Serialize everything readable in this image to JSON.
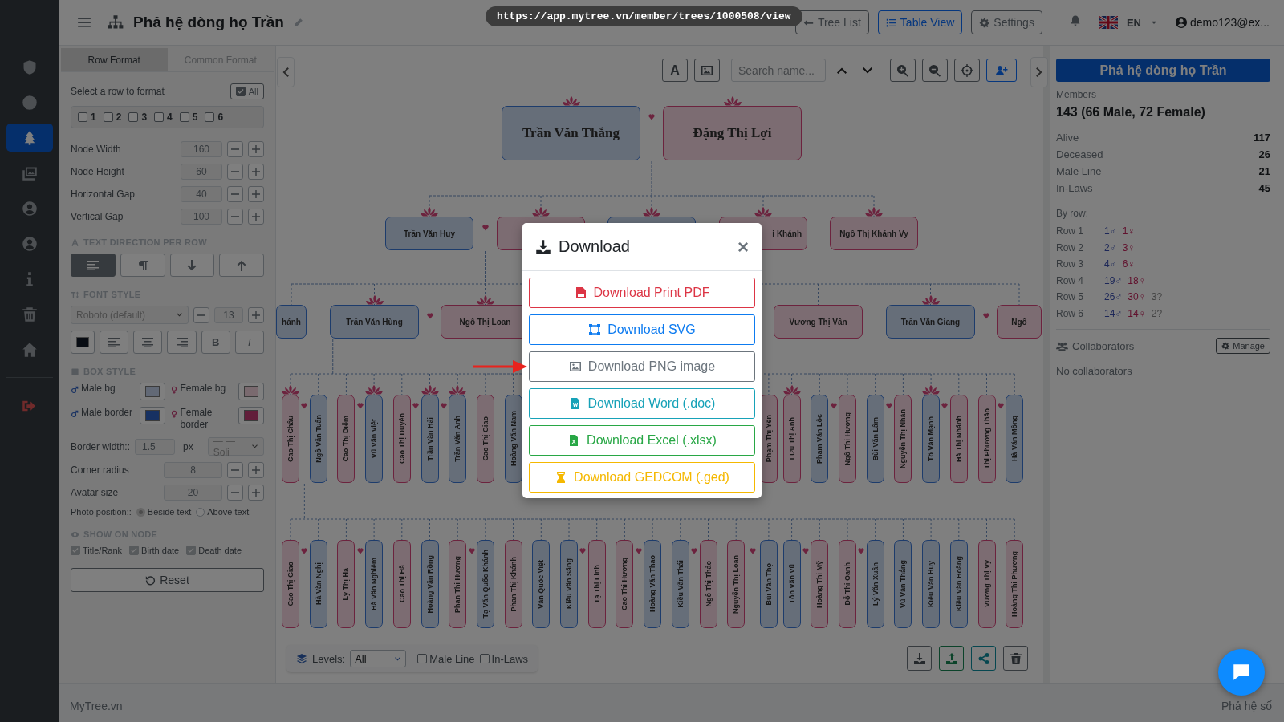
{
  "sidebar": {
    "items": [
      {
        "kind": "shield",
        "selected": false
      },
      {
        "kind": "circle",
        "selected": false
      },
      {
        "kind": "tree",
        "selected": true
      },
      {
        "kind": "images",
        "selected": false
      },
      {
        "kind": "user-circle",
        "selected": false
      },
      {
        "kind": "user-circle",
        "selected": false
      },
      {
        "kind": "info",
        "selected": false
      },
      {
        "kind": "trash",
        "selected": false
      },
      {
        "kind": "home",
        "selected": false
      },
      {
        "kind": "sign-out",
        "selected": false
      }
    ]
  },
  "header": {
    "title": "Phả hệ dòng họ Trần",
    "url": "https://app.mytree.vn/member/trees/1000508/view",
    "buttons": [
      {
        "label": "Tree List",
        "kind": "back",
        "selected": false
      },
      {
        "label": "Table View",
        "kind": "list",
        "selected": true
      },
      {
        "label": "Settings",
        "kind": "gear",
        "selected": false
      }
    ],
    "language": "EN",
    "user": "demo123@ex..."
  },
  "format_panel": {
    "tabs": [
      {
        "label": "Row Format",
        "selected": true
      },
      {
        "label": "Common Format",
        "selected": false
      }
    ],
    "row_select": {
      "label": "Select a row to format",
      "all": {
        "label": "All",
        "checked": true
      },
      "rows": [
        {
          "label": "1",
          "checked": false
        },
        {
          "label": "2",
          "checked": false
        },
        {
          "label": "3",
          "checked": false
        },
        {
          "label": "4",
          "checked": false
        },
        {
          "label": "5",
          "checked": false
        },
        {
          "label": "6",
          "checked": false
        }
      ]
    },
    "size_fields": [
      {
        "label": "Node Width",
        "value": "160"
      },
      {
        "label": "Node Height",
        "value": "60"
      },
      {
        "label": "Horizontal Gap",
        "value": "40"
      },
      {
        "label": "Vertical Gap",
        "value": "100"
      }
    ],
    "text_direction": {
      "title": "TEXT DIRECTION PER ROW",
      "options": [
        {
          "kind": "align-left",
          "selected": true
        },
        {
          "kind": "pilcrow",
          "selected": false
        },
        {
          "kind": "arrow-down",
          "selected": false
        },
        {
          "kind": "arrow-up",
          "selected": false
        }
      ]
    },
    "font_style": {
      "title": "FONT STYLE",
      "font": "Roboto (default)",
      "size": "13",
      "buttons": [
        {
          "kind": "align-left"
        },
        {
          "kind": "align-center"
        },
        {
          "kind": "align-right"
        },
        {
          "kind": "bold",
          "label": "B"
        },
        {
          "kind": "italic",
          "label": "I"
        }
      ]
    },
    "box_style": {
      "title": "BOX STYLE",
      "swatches": [
        {
          "label": "Male bg",
          "kind": "male-bg"
        },
        {
          "label": "Female bg",
          "kind": "female-bg"
        },
        {
          "label": "Male border",
          "kind": "male-border"
        },
        {
          "label": "Female border",
          "kind": "female-border"
        }
      ],
      "border_width": {
        "label": "Border width::",
        "value": "1.5",
        "unit": "px",
        "style": "— — Soli"
      },
      "steppers": [
        {
          "label": "Corner radius",
          "value": "8"
        },
        {
          "label": "Avatar size",
          "value": "20"
        }
      ],
      "photo_position": {
        "label": "Photo position::",
        "options": [
          {
            "label": "Beside text",
            "selected": true
          },
          {
            "label": "Above text",
            "selected": false
          }
        ]
      }
    },
    "show_on_node": {
      "title": "SHOW ON NODE",
      "options": [
        {
          "label": "Title/Rank",
          "checked": true
        },
        {
          "label": "Birth date",
          "checked": true
        },
        {
          "label": "Death date",
          "checked": true
        }
      ]
    },
    "reset": "Reset"
  },
  "canvas": {
    "toolbar": {
      "font_button": "A",
      "search_placeholder": "Search name..."
    },
    "tree": [
      {
        "nodes": [
          {
            "name": "Trần Văn Thắng",
            "kind": "male",
            "lotus": true,
            "married": true
          },
          {
            "name": "Đặng Thị Lợi",
            "kind": "female",
            "lotus": true,
            "married": false
          }
        ]
      },
      {
        "nodes": [
          {
            "name": "Trần Văn Huy",
            "kind": "male",
            "lotus": true,
            "married": true
          },
          {
            "kind": "female",
            "lotus": true
          },
          {
            "kind": "male",
            "lotus": true
          },
          {
            "name": "i Khánh",
            "kind": "female",
            "lotus": true,
            "married": false
          },
          {
            "name": "Ngô Thị Khánh Vy",
            "kind": "female",
            "lotus": true,
            "married": false
          }
        ]
      },
      {
        "nodes": [
          {
            "name": "hánh",
            "kind": "male",
            "lotus": false,
            "married": false
          },
          {
            "name": "Trần Văn Hùng",
            "kind": "male",
            "lotus": true,
            "married": true
          },
          {
            "name": "Ngô Thị Loan",
            "kind": "female",
            "lotus": true,
            "married": false
          },
          {
            "name": "Vương Thị Vân",
            "kind": "female",
            "lotus": false,
            "married": false
          },
          {
            "name": "Trần Văn Giang",
            "kind": "male",
            "lotus": true,
            "married": true
          },
          {
            "name": "Ngô",
            "kind": "female",
            "lotus": false,
            "married": false
          }
        ]
      },
      {
        "nodes": [
          {
            "name": "Cao Thị Châu",
            "kind": "female",
            "lotus": true,
            "married": true
          },
          {
            "name": "Ngô Văn Tuấn",
            "kind": "male",
            "lotus": false,
            "married": false
          },
          {
            "name": "Cao Thị Diễm",
            "kind": "female",
            "lotus": false,
            "married": true
          },
          {
            "name": "Vũ Văn Việt",
            "kind": "male",
            "lotus": true,
            "married": false
          },
          {
            "name": "Cao Thị Duyên",
            "kind": "female",
            "lotus": false,
            "married": true
          },
          {
            "name": "Trần Văn Hải",
            "kind": "male",
            "lotus": true,
            "married": true
          },
          {
            "name": "Trần Văn Anh",
            "kind": "male",
            "lotus": true,
            "married": false
          },
          {
            "name": "Cao Thị Giao",
            "kind": "female",
            "lotus": false,
            "married": false
          },
          {
            "name": "Hoàng Văn Nam",
            "kind": "male",
            "lotus": false,
            "married": false
          },
          {
            "name": "Phạm Thị Yến",
            "kind": "female",
            "lotus": false,
            "married": false
          },
          {
            "name": "Lưu Thị Anh",
            "kind": "female",
            "lotus": true,
            "married": false
          },
          {
            "name": "Phạm Văn Lộc",
            "kind": "male",
            "lotus": false,
            "married": true
          },
          {
            "name": "Ngô Thị Hương",
            "kind": "female",
            "lotus": false,
            "married": false
          },
          {
            "name": "Bùi Văn Lâm",
            "kind": "male",
            "lotus": false,
            "married": true
          },
          {
            "name": "Nguyễn Thị Nhàn",
            "kind": "female",
            "lotus": false,
            "married": false
          },
          {
            "name": "Tô Văn Mạnh",
            "kind": "male",
            "lotus": true,
            "married": true
          },
          {
            "name": "Hà Thị Nhánh",
            "kind": "female",
            "lotus": false,
            "married": false
          },
          {
            "name": "Thị Phương Thảo",
            "kind": "female",
            "lotus": false,
            "married": true
          },
          {
            "name": "Hà Văn Mộng",
            "kind": "male",
            "lotus": false,
            "married": false
          }
        ]
      },
      {
        "nodes": [
          {
            "name": "Cao Thị Giao",
            "kind": "female",
            "lotus": false,
            "married": true
          },
          {
            "name": "Hà Văn Nghị",
            "kind": "male",
            "lotus": false,
            "married": false
          },
          {
            "name": "Lý Thị Hà",
            "kind": "female",
            "lotus": false,
            "married": true
          },
          {
            "name": "Hà Văn Nghiêm",
            "kind": "male",
            "lotus": false,
            "married": false
          },
          {
            "name": "Cao Thị Hà",
            "kind": "female",
            "lotus": false,
            "married": false
          },
          {
            "name": "Hoàng Văn Rồng",
            "kind": "male",
            "lotus": false,
            "married": false
          },
          {
            "name": "Phan Thị Hương",
            "kind": "female",
            "lotus": false,
            "married": true
          },
          {
            "name": "Tạ Văn Quốc Khánh",
            "kind": "male",
            "lotus": false,
            "married": false
          },
          {
            "name": "Phan Thị Khánh",
            "kind": "female",
            "lotus": false,
            "married": false
          },
          {
            "name": "Văn Quốc Việt",
            "kind": "male",
            "lotus": false,
            "married": false
          },
          {
            "name": "Kiều Văn Sáng",
            "kind": "male",
            "lotus": false,
            "married": true
          },
          {
            "name": "Tạ Thị Linh",
            "kind": "female",
            "lotus": false,
            "married": false
          },
          {
            "name": "Cao Thị Hương",
            "kind": "female",
            "lotus": false,
            "married": true
          },
          {
            "name": "Hoàng Văn Thạo",
            "kind": "male",
            "lotus": false,
            "married": false
          },
          {
            "name": "Kiều Văn Thái",
            "kind": "male",
            "lotus": false,
            "married": true
          },
          {
            "name": "Ngô Thị Thảo",
            "kind": "female",
            "lotus": false,
            "married": false
          },
          {
            "name": "Nguyễn Thị Loan",
            "kind": "female",
            "lotus": false,
            "married": true
          },
          {
            "name": "Bùi Văn Thọ",
            "kind": "male",
            "lotus": false,
            "married": false
          },
          {
            "name": "Tôn Văn Vũ",
            "kind": "male",
            "lotus": false,
            "married": true
          },
          {
            "name": "Hoàng Thị Mỹ",
            "kind": "female",
            "lotus": false,
            "married": false
          },
          {
            "name": "Đỗ Thị Oanh",
            "kind": "female",
            "lotus": false,
            "married": true
          },
          {
            "name": "Lý Văn Xuân",
            "kind": "male",
            "lotus": false,
            "married": false
          },
          {
            "name": "Vũ Văn Thắng",
            "kind": "male",
            "lotus": false,
            "married": false
          },
          {
            "name": "Kiều Văn Huy",
            "kind": "male",
            "lotus": false,
            "married": false
          },
          {
            "name": "Kiều Văn Hoàng",
            "kind": "male",
            "lotus": false,
            "married": false
          },
          {
            "name": "Vương Thị Vy",
            "kind": "female",
            "lotus": false,
            "married": false
          },
          {
            "name": "Hoàng Thị Phương",
            "kind": "female",
            "lotus": false,
            "married": false
          }
        ]
      }
    ],
    "levels": {
      "label": "Levels:",
      "value": "All",
      "options": [
        {
          "label": "Male Line",
          "checked": false
        },
        {
          "label": "In-Laws",
          "checked": false
        }
      ]
    },
    "actions": [
      {
        "kind": "download"
      },
      {
        "kind": "upload"
      },
      {
        "kind": "share"
      },
      {
        "kind": "trash"
      }
    ]
  },
  "info_panel": {
    "title": "Phả hệ dòng họ Trần",
    "members_label": "Members",
    "members": "143 (66 Male, 72 Female)",
    "stats": [
      {
        "label": "Alive",
        "value": "117"
      },
      {
        "label": "Deceased",
        "value": "26"
      },
      {
        "label": "Male Line",
        "value": "21"
      },
      {
        "label": "In-Laws",
        "value": "45"
      }
    ],
    "by_row_label": "By row:",
    "rows": [
      {
        "label": "Row 1",
        "male": "1♂",
        "female": "1♀"
      },
      {
        "label": "Row 2",
        "male": "2♂",
        "female": "3♀"
      },
      {
        "label": "Row 3",
        "male": "4♂",
        "female": "6♀"
      },
      {
        "label": "Row 4",
        "male": "19♂",
        "female": "18♀"
      },
      {
        "label": "Row 5",
        "male": "26♂",
        "female": "30♀",
        "unknown": "3?"
      },
      {
        "label": "Row 6",
        "male": "14♂",
        "female": "14♀",
        "unknown": "2?"
      }
    ],
    "collaborators": {
      "title": "Collaborators",
      "button": "Manage",
      "empty": "No collaborators"
    }
  },
  "modal": {
    "title": "Download",
    "close": "×",
    "options": [
      {
        "label": "Download Print PDF",
        "kind": "pdf",
        "color": "#dc3545",
        "pointer": false
      },
      {
        "label": "Download SVG",
        "kind": "svg",
        "color": "#0d7bf0",
        "pointer": false
      },
      {
        "label": "Download PNG image",
        "kind": "png",
        "color": "#6c757d",
        "pointer": true
      },
      {
        "label": "Download Word (.doc)",
        "kind": "word",
        "color": "#17a2b8",
        "pointer": false
      },
      {
        "label": "Download Excel (.xlsx)",
        "kind": "excel",
        "color": "#28a745",
        "pointer": false
      },
      {
        "label": "Download GEDCOM (.ged)",
        "kind": "gedcom",
        "color": "#f5b800",
        "pointer": false
      }
    ]
  },
  "footer": {
    "brand": "MyTree.vn",
    "slogan": "Phả hệ số"
  }
}
